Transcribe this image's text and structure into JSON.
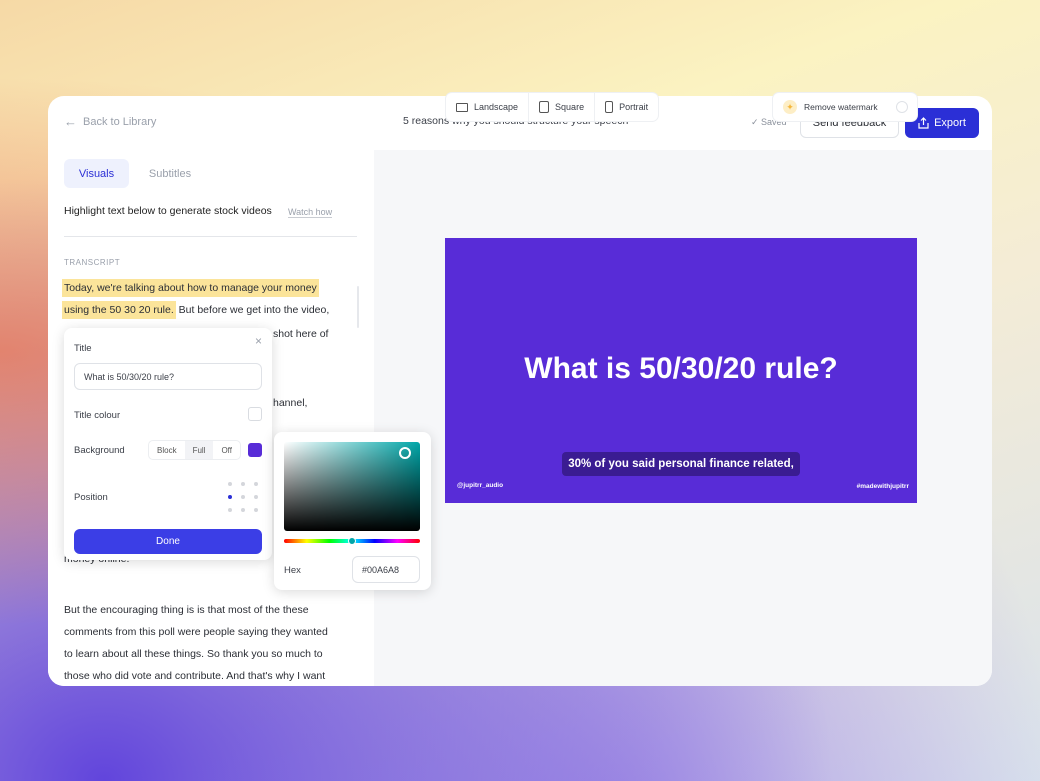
{
  "header": {
    "back_label": "Back to Library",
    "title": "5 reasons why you should structure your speech",
    "saved": "Saved",
    "feedback": "Send feedback",
    "export": "Export"
  },
  "tabs": [
    {
      "label": "Visuals",
      "active": true
    },
    {
      "label": "Subtitles",
      "active": false
    }
  ],
  "hint": "Highlight text below to generate stock videos",
  "watch_how": "Watch how",
  "transcript_label": "TRANSCRIPT",
  "transcript": {
    "highlight1": "Today, we're talking about how to manage your money",
    "highlight2": "using the 50 30 20 rule.",
    "rest2": " But before we get into the video,",
    "frag3": "shot here of",
    "frag5": "hannel,",
    "frag_money": "money online.",
    "para2": [
      " But the encouraging thing is is that most of the these",
      "comments from this poll were people saying they wanted",
      "to learn about all these things. So thank you so much to",
      "those who did vote and contribute. And that's why I want"
    ]
  },
  "popover": {
    "title_label": "Title",
    "title_value": "What is 50/30/20 rule?",
    "title_colour_label": "Title colour",
    "background_label": "Background",
    "bg_options": [
      "Block",
      "Full",
      "Off"
    ],
    "bg_selected": "Full",
    "bg_color": "#582cd7",
    "position_label": "Position",
    "position_selected": "middle-left",
    "done": "Done"
  },
  "color_picker": {
    "hex_label": "Hex",
    "hex_value": "#00A6A8"
  },
  "format": {
    "options": [
      "Landscape",
      "Square",
      "Portrait"
    ],
    "selected": "Landscape"
  },
  "watermark": {
    "label": "Remove watermark",
    "enabled": false
  },
  "slide": {
    "title": "What is 50/30/20 rule?",
    "caption": "30% of you said personal finance related,",
    "handle": "@jupitrr_audio",
    "tag": "#madewithjupitrr"
  }
}
